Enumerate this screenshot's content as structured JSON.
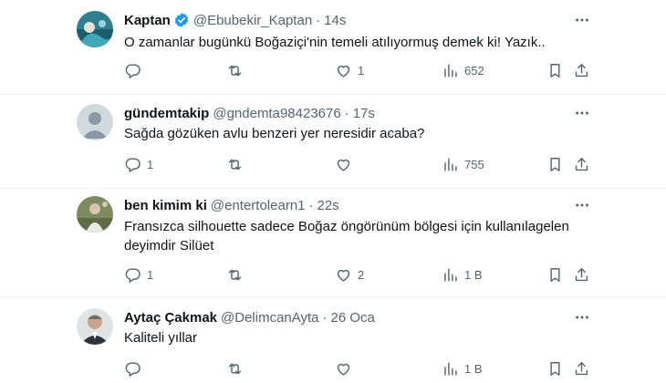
{
  "tweets": [
    {
      "name": "Kaptan",
      "verified": true,
      "handle": "@Ebubekir_Kaptan",
      "time": "14s",
      "text": "O zamanlar bugünkü Boğaziçi'nin temeli atılıyormuş demek ki! Yazık..",
      "reply_count": "",
      "retweet_count": "",
      "like_count": "1",
      "view_count": "652",
      "avatar": "profile-photo"
    },
    {
      "name": "gündemtakip",
      "verified": false,
      "handle": "@gndemta98423676",
      "time": "17s",
      "text": "Sağda gözüken avlu benzeri yer neresidir acaba?",
      "reply_count": "1",
      "retweet_count": "",
      "like_count": "",
      "view_count": "755",
      "avatar": "default-avatar"
    },
    {
      "name": "ben kimim ki",
      "verified": false,
      "handle": "@entertolearn1",
      "time": "22s",
      "text": "Fransızca silhouette sadece Boğaz öngörünüm bölgesi için kullanılagelen deyimdir Silüet",
      "reply_count": "1",
      "retweet_count": "",
      "like_count": "2",
      "view_count": "1 B",
      "avatar": "profile-photo"
    },
    {
      "name": "Aytaç Çakmak",
      "verified": false,
      "handle": "@DelimcanAyta",
      "time": "26 Oca",
      "text": "Kaliteli yıllar",
      "reply_count": "",
      "retweet_count": "",
      "like_count": "",
      "view_count": "1 B",
      "avatar": "profile-photo"
    }
  ],
  "separator": "·",
  "colors": {
    "text": "#0f1419",
    "secondary": "#536471",
    "verified": "#1d9bf0",
    "border": "#eff3f4"
  },
  "icons": [
    "verified-badge-icon",
    "more-icon",
    "reply-icon",
    "retweet-icon",
    "like-icon",
    "views-icon",
    "bookmark-icon",
    "share-icon"
  ]
}
